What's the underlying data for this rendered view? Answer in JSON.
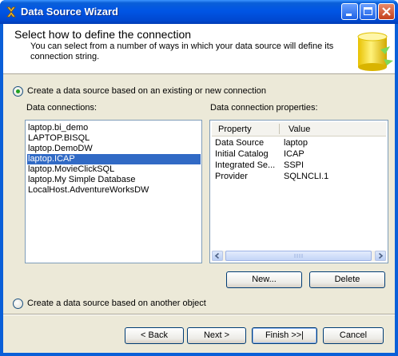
{
  "window": {
    "title": "Data Source Wizard"
  },
  "header": {
    "title": "Select how to define the connection",
    "description": "You can select from a number of ways in which your data source will define its connection string."
  },
  "options": {
    "existing_label": "Create a data source based on an existing or new connection",
    "existing_selected": true,
    "other_label": "Create a data source based on another object",
    "other_selected": false
  },
  "connections": {
    "label": "Data connections:",
    "items": [
      "laptop.bi_demo",
      "LAPTOP.BISQL",
      "laptop.DemoDW",
      "laptop.ICAP",
      "laptop.MovieClickSQL",
      "laptop.My Simple Database",
      "LocalHost.AdventureWorksDW"
    ],
    "selected": "laptop.ICAP"
  },
  "properties": {
    "label": "Data connection properties:",
    "columns": [
      "Property",
      "Value"
    ],
    "rows": [
      {
        "property": "Data Source",
        "value": "laptop"
      },
      {
        "property": "Initial Catalog",
        "value": "ICAP"
      },
      {
        "property": "Integrated Se...",
        "value": "SSPI"
      },
      {
        "property": "Provider",
        "value": "SQLNCLI.1"
      }
    ]
  },
  "buttons": {
    "new": "New...",
    "delete": "Delete",
    "back": "< Back",
    "next": "Next >",
    "finish": "Finish >>|",
    "cancel": "Cancel"
  },
  "icons": {
    "app": "wizard-app-icon",
    "minimize": "minimize-icon",
    "maximize": "maximize-icon",
    "close": "close-icon",
    "header_graphic": "database-cylinder-icon",
    "scroll_left": "chevron-left-icon",
    "scroll_right": "chevron-right-icon"
  },
  "colors": {
    "titlebar": "#0055e5",
    "selection": "#316ac5",
    "dialog_bg": "#ece9d8"
  }
}
